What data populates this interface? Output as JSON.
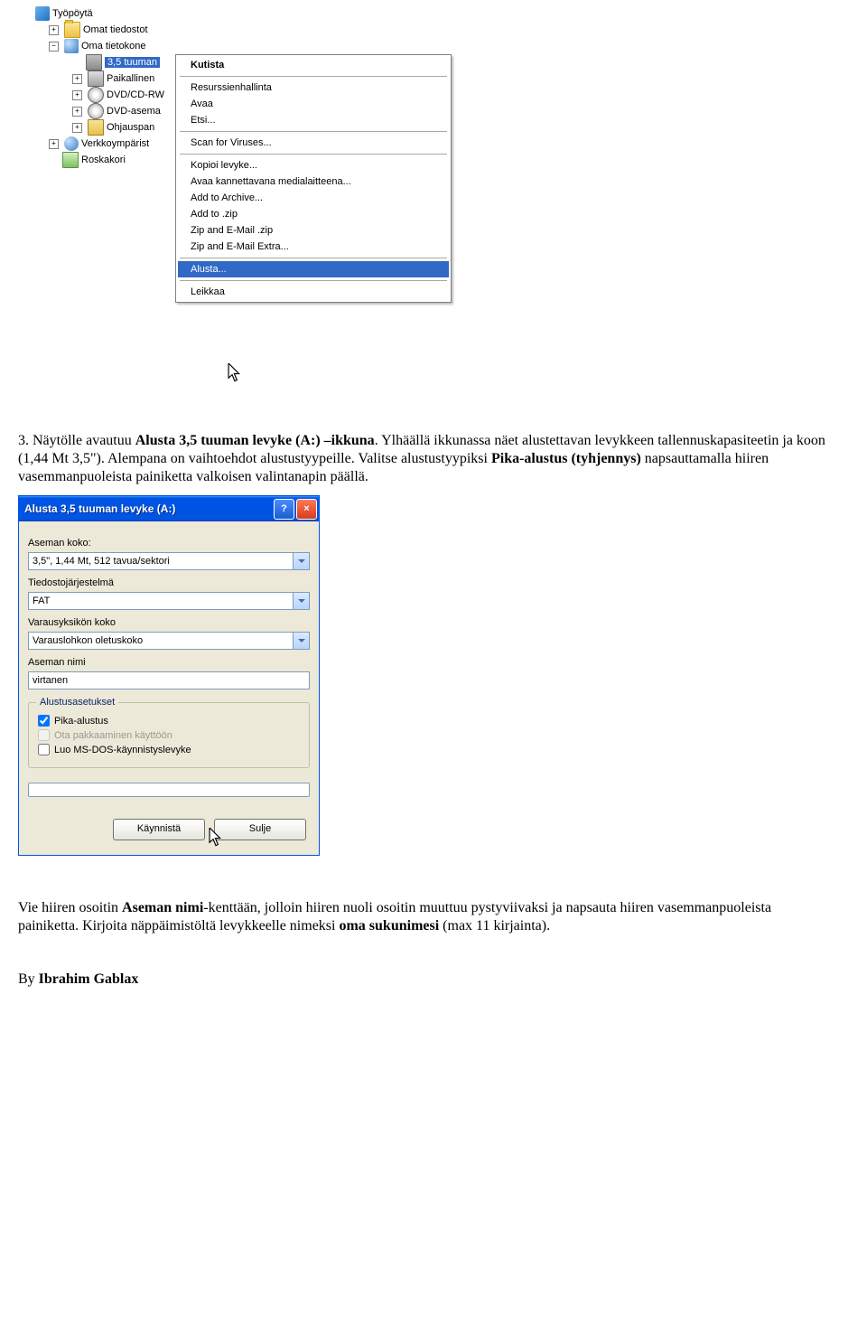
{
  "tree": {
    "desktop": "Työpöytä",
    "mydocs": "Omat tiedostot",
    "mycomputer": "Oma tietokone",
    "floppy_sel": "3,5 tuuman",
    "local": "Paikallinen",
    "dvdcdrw": "DVD/CD-RW",
    "dvdrom": "DVD-asema",
    "ctrlpanel": "Ohjauspan",
    "network": "Verkkoympärist",
    "recycle": "Roskakori"
  },
  "menu": {
    "collapse": "Kutista",
    "explore": "Resurssienhallinta",
    "open": "Avaa",
    "search": "Etsi...",
    "scan": "Scan for Viruses...",
    "copydisk": "Kopioi levyke...",
    "openportable": "Avaa kannettavana medialaitteena...",
    "addarchive": "Add to Archive...",
    "addzip": "Add to .zip",
    "zipmail": "Zip and E-Mail .zip",
    "zipmailx": "Zip and E-Mail Extra...",
    "format": "Alusta...",
    "cut": "Leikkaa"
  },
  "para1_a": "3. Näytölle avautuu ",
  "para1_b": "Alusta 3,5 tuuman levyke (A:) –ikkuna",
  "para1_c": ". Ylhäällä ikkunassa näet alustettavan levykkeen tallennuskapasiteetin ja koon (1,44 Mt 3,5\"). Alempana on vaihtoehdot alustustyypeille. Valitse alustustyypiksi ",
  "para1_d": "Pika-alustus (tyhjennys)",
  "para1_e": " napsauttamalla hiiren vasemmanpuoleista painiketta valkoisen valintanapin päällä.",
  "dlg": {
    "title": "Alusta 3,5 tuuman levyke (A:)",
    "lbl_size": "Aseman koko:",
    "val_size": "3,5\", 1,44 Mt, 512 tavua/sektori",
    "lbl_fs": "Tiedostojärjestelmä",
    "val_fs": "FAT",
    "lbl_alloc": "Varausyksikön koko",
    "val_alloc": "Varauslohkon oletuskoko",
    "lbl_volname": "Aseman nimi",
    "val_volname": "virtanen",
    "grp": "Alustusasetukset",
    "chk_quick": "Pika-alustus",
    "chk_compress": "Ota pakkaaminen käyttöön",
    "chk_msdos": "Luo MS-DOS-käynnistyslevyke",
    "btn_start": "Käynnistä",
    "btn_close": "Sulje"
  },
  "para2_a": "Vie hiiren osoitin ",
  "para2_b": "Aseman nimi",
  "para2_c": "-kenttään, jolloin hiiren nuoli osoitin muuttuu pystyviivaksi ja napsauta hiiren vasemmanpuoleista painiketta. Kirjoita näppäimistöltä levykkeelle nimeksi ",
  "para2_d": "oma sukunimesi",
  "para2_e": " (max 11 kirjainta).",
  "author_a": "By ",
  "author_b": "Ibrahim Gablax"
}
